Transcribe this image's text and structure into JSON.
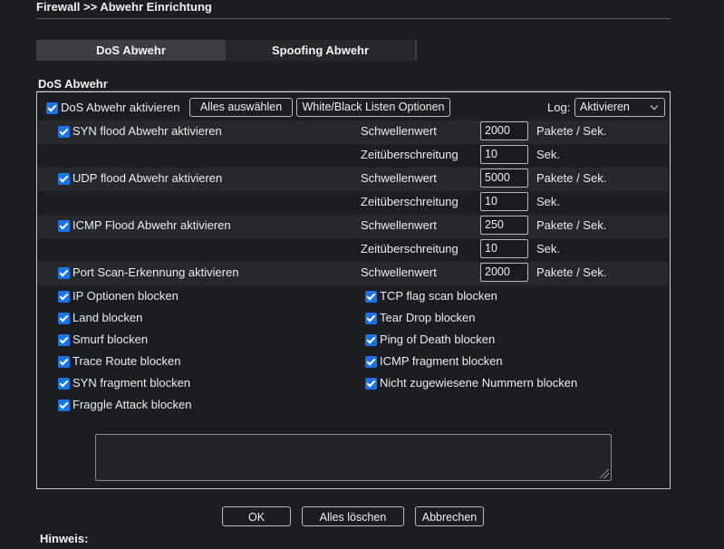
{
  "page": {
    "title": "Firewall >> Abwehr Einrichtung"
  },
  "tabs": [
    {
      "label": "DoS Abwehr",
      "active": true
    },
    {
      "label": "Spoofing Abwehr",
      "active": false
    }
  ],
  "section": {
    "label": "DoS Abwehr"
  },
  "header_row": {
    "enable_label": "DoS Abwehr aktivieren",
    "enable_checked": true,
    "select_all_label": "Alles auswählen",
    "lists_label": "White/Black Listen Optionen",
    "log_label": "Log:",
    "log_value": "Aktivieren"
  },
  "floods": [
    {
      "label": "SYN flood Abwehr aktivieren",
      "checked": true,
      "threshold_label": "Schwellenwert",
      "threshold": "2000",
      "threshold_unit": "Pakete / Sek.",
      "timeout_label": "Zeitüberschreitung",
      "timeout": "10",
      "timeout_unit": "Sek."
    },
    {
      "label": "UDP flood Abwehr aktivieren",
      "checked": true,
      "threshold_label": "Schwellenwert",
      "threshold": "5000",
      "threshold_unit": "Pakete / Sek.",
      "timeout_label": "Zeitüberschreitung",
      "timeout": "10",
      "timeout_unit": "Sek."
    },
    {
      "label": "ICMP Flood Abwehr aktivieren",
      "checked": true,
      "threshold_label": "Schwellenwert",
      "threshold": "250",
      "threshold_unit": "Pakete / Sek.",
      "timeout_label": "Zeitüberschreitung",
      "timeout": "10",
      "timeout_unit": "Sek."
    }
  ],
  "port_scan": {
    "label": "Port Scan-Erkennung aktivieren",
    "checked": true,
    "threshold_label": "Schwellenwert",
    "threshold": "2000",
    "threshold_unit": "Pakete / Sek."
  },
  "left_options": [
    {
      "label": "IP Optionen blocken",
      "checked": true
    },
    {
      "label": "Land blocken",
      "checked": true
    },
    {
      "label": "Smurf blocken",
      "checked": true
    },
    {
      "label": "Trace Route blocken",
      "checked": true
    },
    {
      "label": "SYN fragment blocken",
      "checked": true
    },
    {
      "label": "Fraggle Attack blocken",
      "checked": true
    }
  ],
  "right_options": [
    {
      "label": "TCP flag scan blocken",
      "checked": true
    },
    {
      "label": "Tear Drop blocken",
      "checked": true
    },
    {
      "label": "Ping of Death blocken",
      "checked": true
    },
    {
      "label": "ICMP fragment blocken",
      "checked": true
    },
    {
      "label": "Nicht zugewiesene Nummern blocken",
      "checked": true
    }
  ],
  "log_textarea": {
    "value": ""
  },
  "footer": {
    "ok_label": "OK",
    "clear_label": "Alles löschen",
    "cancel_label": "Abbrechen"
  },
  "hint": {
    "label": "Hinweis:"
  },
  "colors": {
    "accent": "#1a73e8",
    "background": "#1c1d20",
    "row_highlight": "#26282b"
  }
}
